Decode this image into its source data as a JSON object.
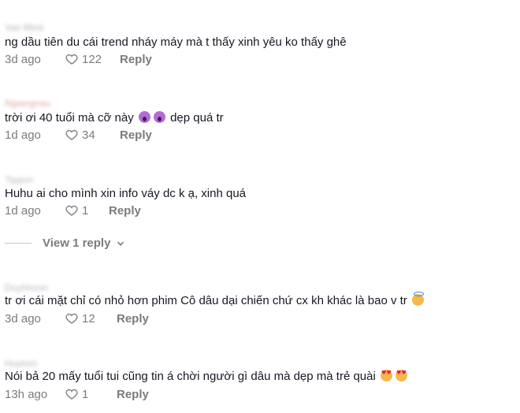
{
  "comments": [
    {
      "username": "Van Mimi",
      "text": "ng dầu tiên du cái trend nháy máy mà t thấy xinh yêu ko thấy ghê",
      "age": "3d ago",
      "likes": "122",
      "reply_label": "Reply"
    },
    {
      "username": "Ngiangnau",
      "text_before": "trời ơi 40 tuổi mà cỡ này",
      "text_after": "dẹp quá tr",
      "age": "1d ago",
      "likes": "34",
      "reply_label": "Reply"
    },
    {
      "username": "Tippon",
      "text": "Huhu ai cho mình xin info váy dc k ạ, xinh quá",
      "age": "1d ago",
      "likes": "1",
      "reply_label": "Reply"
    },
    {
      "username": "Duyhhoon",
      "text": "tr ơi cái mặt chỉ có nhỏ hơn phim Cô dâu dại chiến chứ cx kh khác là bao v tr",
      "age": "3d ago",
      "likes": "12",
      "reply_label": "Reply"
    },
    {
      "username": "Huytom",
      "text": "Nói bả 20 mấy tuổi tui cũng tin á chời người gì dâu mà dẹp mà trẻ quài",
      "age": "13h ago",
      "likes": "1",
      "reply_label": "Reply"
    }
  ],
  "view_replies_label": "View 1 reply",
  "icons": {
    "like": "heart-outline-icon",
    "expand": "chevron-down-icon",
    "emoji_scream": "face-screaming-icon",
    "emoji_halo": "smiling-face-with-halo-icon",
    "emoji_heart_eyes": "heart-eyes-icon"
  },
  "colors": {
    "text": "#161823",
    "muted": "#7a7b80"
  }
}
